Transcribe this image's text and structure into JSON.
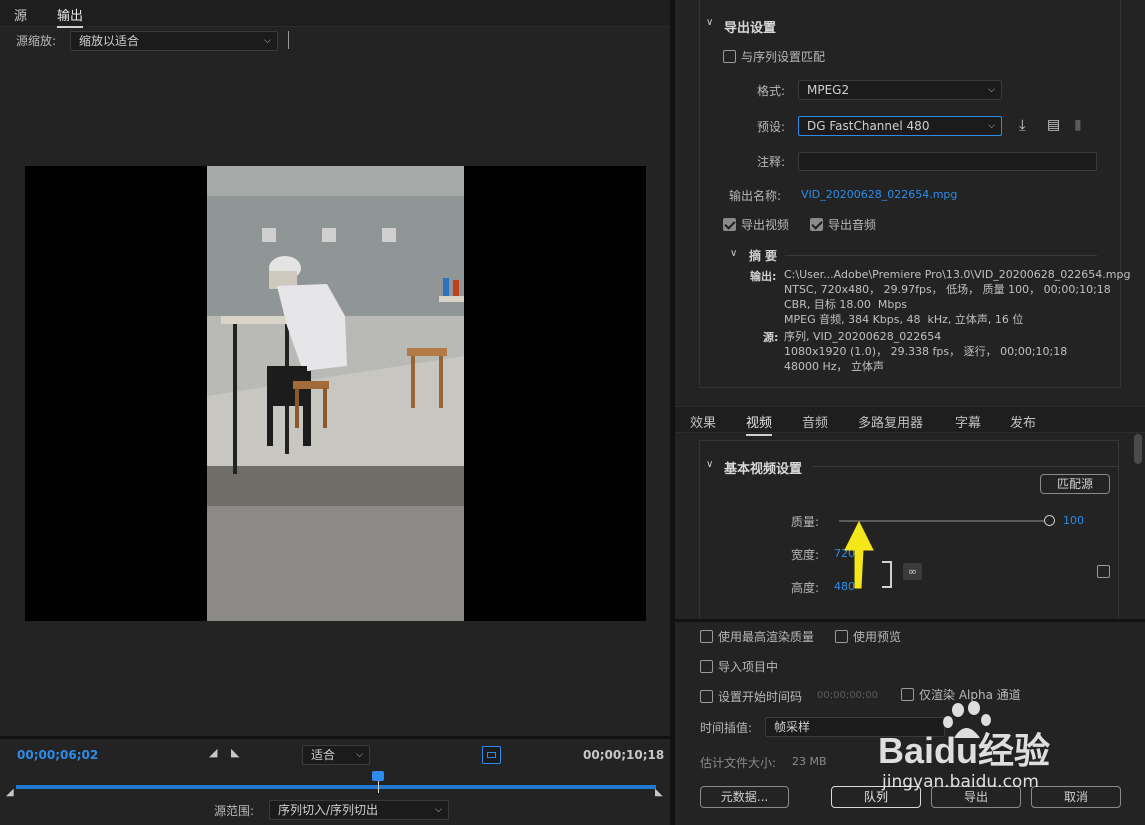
{
  "left": {
    "tabs": [
      "源",
      "输出"
    ],
    "active_tab": "输出",
    "source_scale_label": "源缩放:",
    "source_scale_value": "缩放以适合",
    "timecode_current": "00;00;06;02",
    "fit_value": "适合",
    "timecode_end": "00;00;10;18",
    "source_range_label": "源范围:",
    "source_range_value": "序列切入/序列切出",
    "playhead_progress": 0.566
  },
  "export_settings": {
    "section_title": "导出设置",
    "match_sequence_label": "与序列设置匹配",
    "format_label": "格式:",
    "format_value": "MPEG2",
    "preset_label": "预设:",
    "preset_value": "DG FastChannel 480",
    "comment_label": "注释:",
    "comment_value": "",
    "output_name_label": "输出名称:",
    "output_name_value": "VID_20200628_022654.mpg",
    "export_video_label": "导出视频",
    "export_audio_label": "导出音频",
    "summary_title": "摘要",
    "summary_output_label": "输出:",
    "summary_output_lines": "C:\\User...Adobe\\Premiere Pro\\13.0\\VID_20200628_022654.mpg\nNTSC, 720x480， 29.97fps， 低场， 质量 100， 00;00;10;18\nCBR, 目标 18.00  Mbps\nMPEG 音频, 384 Kbps, 48  kHz, 立体声, 16 位",
    "summary_source_label": "源:",
    "summary_source_lines": "序列, VID_20200628_022654\n1080x1920 (1.0)， 29.338 fps， 逐行， 00;00;10;18\n48000 Hz， 立体声"
  },
  "settings_tabs": [
    "效果",
    "视频",
    "音频",
    "多路复用器",
    "字幕",
    "发布"
  ],
  "active_settings_tab": "视频",
  "video_settings": {
    "section_title": "基本视频设置",
    "match_source_button": "匹配源",
    "quality_label": "质量:",
    "quality_value": "100",
    "width_label": "宽度:",
    "width_value": "720",
    "height_label": "高度:",
    "height_value": "480"
  },
  "bottom_options": {
    "max_render_quality": "使用最高渲染质量",
    "use_previews": "使用预览",
    "import_into_project": "导入项目中",
    "set_start_timecode": "设置开始时间码",
    "start_timecode_value": "00;00;00;00",
    "render_alpha_only": "仅渲染 Alpha 通道",
    "time_interpolation_label": "时间插值:",
    "time_interpolation_value": "帧采样",
    "estimated_size_label": "估计文件大小:",
    "estimated_size_value": "23 MB"
  },
  "buttons": {
    "metadata": "元数据...",
    "queue": "队列",
    "export": "导出",
    "cancel": "取消"
  },
  "watermark": {
    "brand": "Baidu经验",
    "url": "jingyan.baidu.com"
  },
  "colors": {
    "accent_blue": "#2d8ceb",
    "arrow_yellow": "#f5e61a",
    "panel_bg": "#232323"
  }
}
